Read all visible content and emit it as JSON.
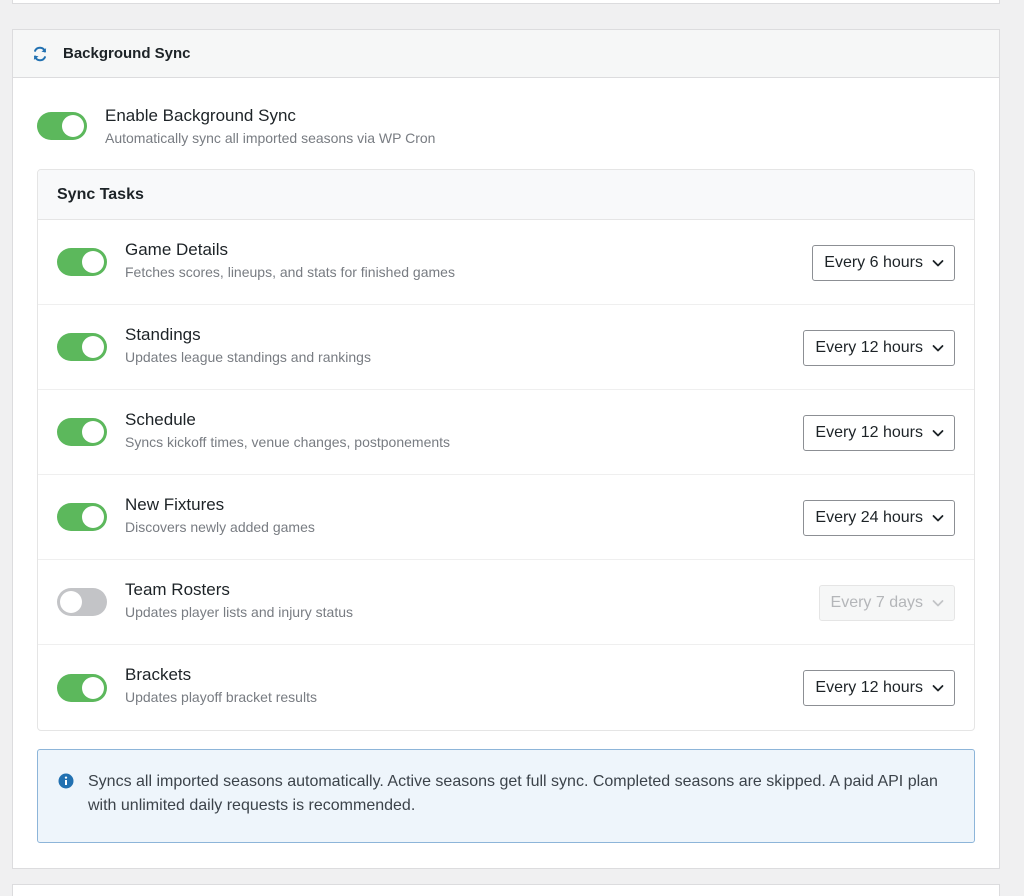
{
  "panel": {
    "title": "Background Sync",
    "icon": "sync-icon"
  },
  "master": {
    "title": "Enable Background Sync",
    "description": "Automatically sync all imported seasons via WP Cron",
    "enabled": true
  },
  "tasks": {
    "header": "Sync Tasks",
    "items": [
      {
        "title": "Game Details",
        "description": "Fetches scores, lineups, and stats for finished games",
        "enabled": true,
        "frequency": "Every 6 hours"
      },
      {
        "title": "Standings",
        "description": "Updates league standings and rankings",
        "enabled": true,
        "frequency": "Every 12 hours"
      },
      {
        "title": "Schedule",
        "description": "Syncs kickoff times, venue changes, postponements",
        "enabled": true,
        "frequency": "Every 12 hours"
      },
      {
        "title": "New Fixtures",
        "description": "Discovers newly added games",
        "enabled": true,
        "frequency": "Every 24 hours"
      },
      {
        "title": "Team Rosters",
        "description": "Updates player lists and injury status",
        "enabled": false,
        "frequency": "Every 7 days"
      },
      {
        "title": "Brackets",
        "description": "Updates playoff bracket results",
        "enabled": true,
        "frequency": "Every 12 hours"
      }
    ]
  },
  "notice": {
    "icon": "info-icon",
    "text": "Syncs all imported seasons automatically. Active seasons get full sync. Completed seasons are skipped. A paid API plan with unlimited daily requests is recommended."
  },
  "colors": {
    "toggle_on": "#5cb85c",
    "toggle_off": "#c3c4c7",
    "accent": "#2271b1",
    "notice_bg": "#eef5fb",
    "notice_border": "#8db5d9"
  }
}
